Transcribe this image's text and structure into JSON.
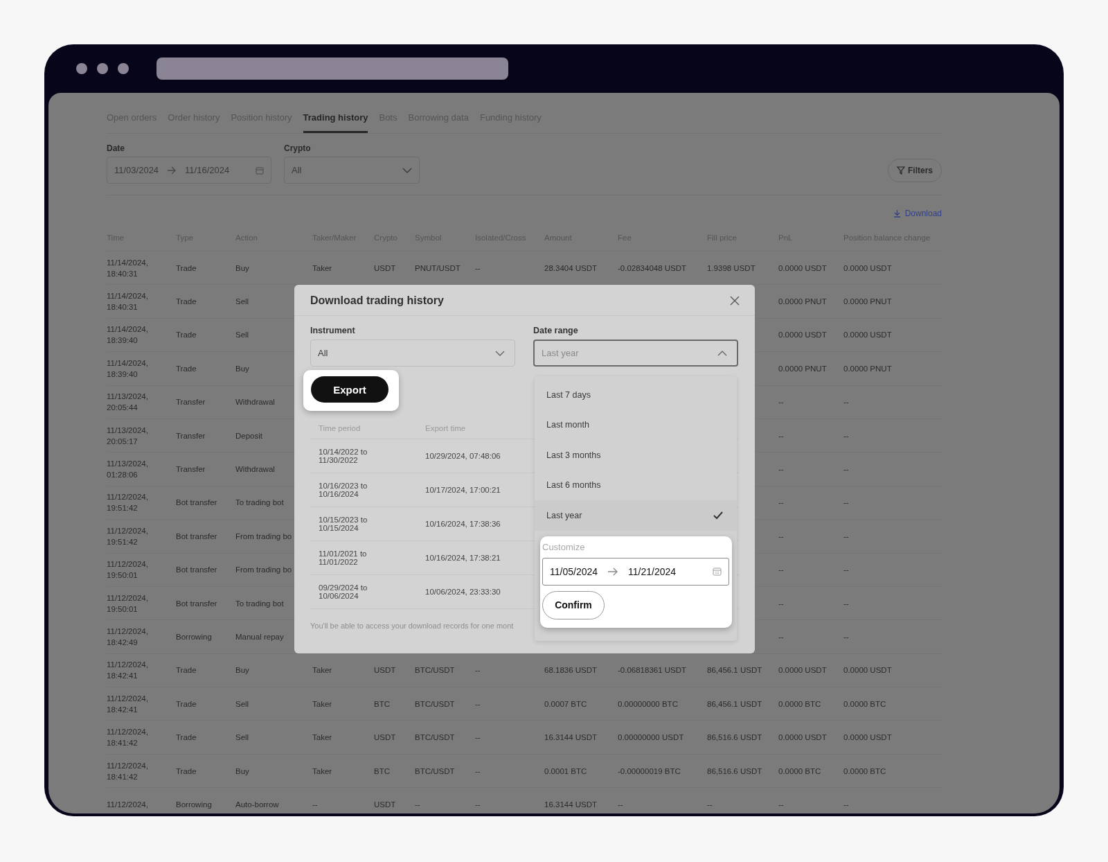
{
  "tabs": [
    {
      "label": "Open orders",
      "selected": false
    },
    {
      "label": "Order history",
      "selected": false
    },
    {
      "label": "Position history",
      "selected": false
    },
    {
      "label": "Trading history",
      "selected": true
    },
    {
      "label": "Bots",
      "selected": false
    },
    {
      "label": "Borrowing data",
      "selected": false
    },
    {
      "label": "Funding history",
      "selected": false
    }
  ],
  "filters": {
    "date_label": "Date",
    "date_from": "11/03/2024",
    "date_to": "11/16/2024",
    "crypto_label": "Crypto",
    "crypto_value": "All",
    "filters_button": "Filters"
  },
  "download_link": "Download",
  "table": {
    "columns": [
      "Time",
      "Type",
      "Action",
      "Taker/Maker",
      "Crypto",
      "Symbol",
      "Isolated/Cross",
      "Amount",
      "Fee",
      "Fill price",
      "PnL",
      "Position balance change"
    ],
    "rows": [
      {
        "cells": [
          "11/14/2024, 18:40:31",
          "Trade",
          "Buy",
          "Taker",
          "USDT",
          "PNUT/USDT",
          "--",
          "28.3404 USDT",
          "-0.02834048 USDT",
          "1.9398 USDT",
          "0.0000 USDT",
          "0.0000 USDT"
        ]
      },
      {
        "cells": [
          "11/14/2024, 18:40:31",
          "Trade",
          "Sell",
          null,
          null,
          null,
          null,
          null,
          null,
          null,
          "0.0000 PNUT",
          "0.0000 PNUT"
        ]
      },
      {
        "cells": [
          "11/14/2024, 18:39:40",
          "Trade",
          "Sell",
          null,
          null,
          null,
          null,
          null,
          null,
          null,
          "0.0000 USDT",
          "0.0000 USDT"
        ]
      },
      {
        "cells": [
          "11/14/2024, 18:39:40",
          "Trade",
          "Buy",
          null,
          null,
          null,
          null,
          null,
          null,
          null,
          "0.0000 PNUT",
          "0.0000 PNUT"
        ]
      },
      {
        "cells": [
          "11/13/2024, 20:05:44",
          "Transfer",
          "Withdrawal",
          null,
          null,
          null,
          null,
          null,
          null,
          null,
          "--",
          "--"
        ]
      },
      {
        "cells": [
          "11/13/2024, 20:05:17",
          "Transfer",
          "Deposit",
          null,
          null,
          null,
          null,
          null,
          null,
          null,
          "--",
          "--"
        ]
      },
      {
        "cells": [
          "11/13/2024, 01:28:06",
          "Transfer",
          "Withdrawal",
          null,
          null,
          null,
          null,
          null,
          null,
          null,
          "--",
          "--"
        ]
      },
      {
        "cells": [
          "11/12/2024, 19:51:42",
          "Bot transfer",
          "To trading bot",
          null,
          null,
          null,
          null,
          null,
          null,
          null,
          "--",
          "--"
        ]
      },
      {
        "cells": [
          "11/12/2024, 19:51:42",
          "Bot transfer",
          "From trading bo",
          null,
          null,
          null,
          null,
          null,
          null,
          null,
          "--",
          "--"
        ]
      },
      {
        "cells": [
          "11/12/2024, 19:50:01",
          "Bot transfer",
          "From trading bo",
          null,
          null,
          null,
          null,
          null,
          null,
          null,
          "--",
          "--"
        ]
      },
      {
        "cells": [
          "11/12/2024, 19:50:01",
          "Bot transfer",
          "To trading bot",
          null,
          null,
          null,
          null,
          null,
          null,
          null,
          "--",
          "--"
        ]
      },
      {
        "cells": [
          "11/12/2024, 18:42:49",
          "Borrowing",
          "Manual repay",
          null,
          null,
          null,
          null,
          null,
          null,
          null,
          "--",
          "--"
        ]
      },
      {
        "cells": [
          "11/12/2024, 18:42:41",
          "Trade",
          "Buy",
          "Taker",
          "USDT",
          "BTC/USDT",
          "--",
          "68.1836 USDT",
          "-0.06818361 USDT",
          "86,456.1 USDT",
          "0.0000 USDT",
          "0.0000 USDT"
        ]
      },
      {
        "cells": [
          "11/12/2024, 18:42:41",
          "Trade",
          "Sell",
          "Taker",
          "BTC",
          "BTC/USDT",
          "--",
          "0.0007 BTC",
          "0.00000000 BTC",
          "86,456.1 USDT",
          "0.0000 BTC",
          "0.0000 BTC"
        ]
      },
      {
        "cells": [
          "11/12/2024, 18:41:42",
          "Trade",
          "Sell",
          "Taker",
          "USDT",
          "BTC/USDT",
          "--",
          "16.3144 USDT",
          "0.00000000 USDT",
          "86,516.6 USDT",
          "0.0000 USDT",
          "0.0000 USDT"
        ]
      },
      {
        "cells": [
          "11/12/2024, 18:41:42",
          "Trade",
          "Buy",
          "Taker",
          "BTC",
          "BTC/USDT",
          "--",
          "0.0001 BTC",
          "-0.00000019 BTC",
          "86,516.6 USDT",
          "0.0000 BTC",
          "0.0000 BTC"
        ]
      },
      {
        "cells": [
          "11/12/2024,",
          "Borrowing",
          "Auto-borrow",
          "--",
          "USDT",
          "--",
          "--",
          "16.3144 USDT",
          "--",
          "--",
          "--",
          "--"
        ]
      }
    ]
  },
  "modal": {
    "title": "Download trading history",
    "instrument_label": "Instrument",
    "instrument_value": "All",
    "date_range_label": "Date range",
    "date_range_value": "Last year",
    "date_range_open": true,
    "export_button": "Export",
    "history_columns": [
      "Time period",
      "Export time"
    ],
    "history_rows": [
      {
        "time_period": "10/14/2022 to 11/30/2022",
        "export_time": "10/29/2024, 07:48:06"
      },
      {
        "time_period": "10/16/2023 to 10/16/2024",
        "export_time": "10/17/2024, 17:00:21"
      },
      {
        "time_period": "10/15/2023 to 10/15/2024",
        "export_time": "10/16/2024, 17:38:36"
      },
      {
        "time_period": "11/01/2021 to 11/01/2022",
        "export_time": "10/16/2024, 17:38:21"
      },
      {
        "time_period": "09/29/2024 to 10/06/2024",
        "export_time": "10/06/2024, 23:33:30"
      }
    ],
    "note": "You'll be able to access your download records for one mont",
    "date_range_options": [
      {
        "label": "Last 7 days",
        "selected": false
      },
      {
        "label": "Last month",
        "selected": false
      },
      {
        "label": "Last 3 months",
        "selected": false
      },
      {
        "label": "Last 6 months",
        "selected": false
      },
      {
        "label": "Last year",
        "selected": true
      }
    ],
    "customize": {
      "label": "Customize",
      "from": "11/05/2024",
      "to": "11/21/2024",
      "confirm_button": "Confirm"
    }
  }
}
